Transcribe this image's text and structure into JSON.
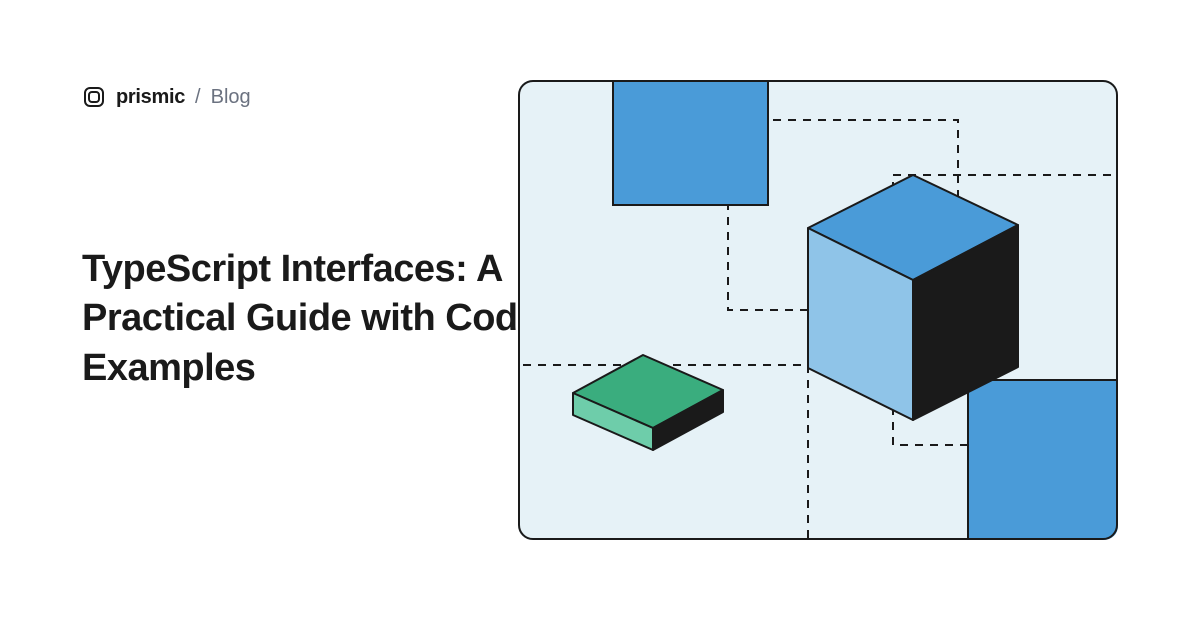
{
  "header": {
    "brand": "prismic",
    "separator": "/",
    "section": "Blog"
  },
  "title": "TypeScript Interfaces: A Practical Guide with Code Examples",
  "colors": {
    "text_primary": "#1a1a1a",
    "text_secondary": "#6b7280",
    "illustration_bg": "#e6f2f7",
    "blue_mid": "#4a9bd8",
    "blue_light": "#8fc4e8",
    "green_top": "#3aad7e",
    "green_side": "#6ecdaa",
    "dark": "#1a1a1a"
  }
}
